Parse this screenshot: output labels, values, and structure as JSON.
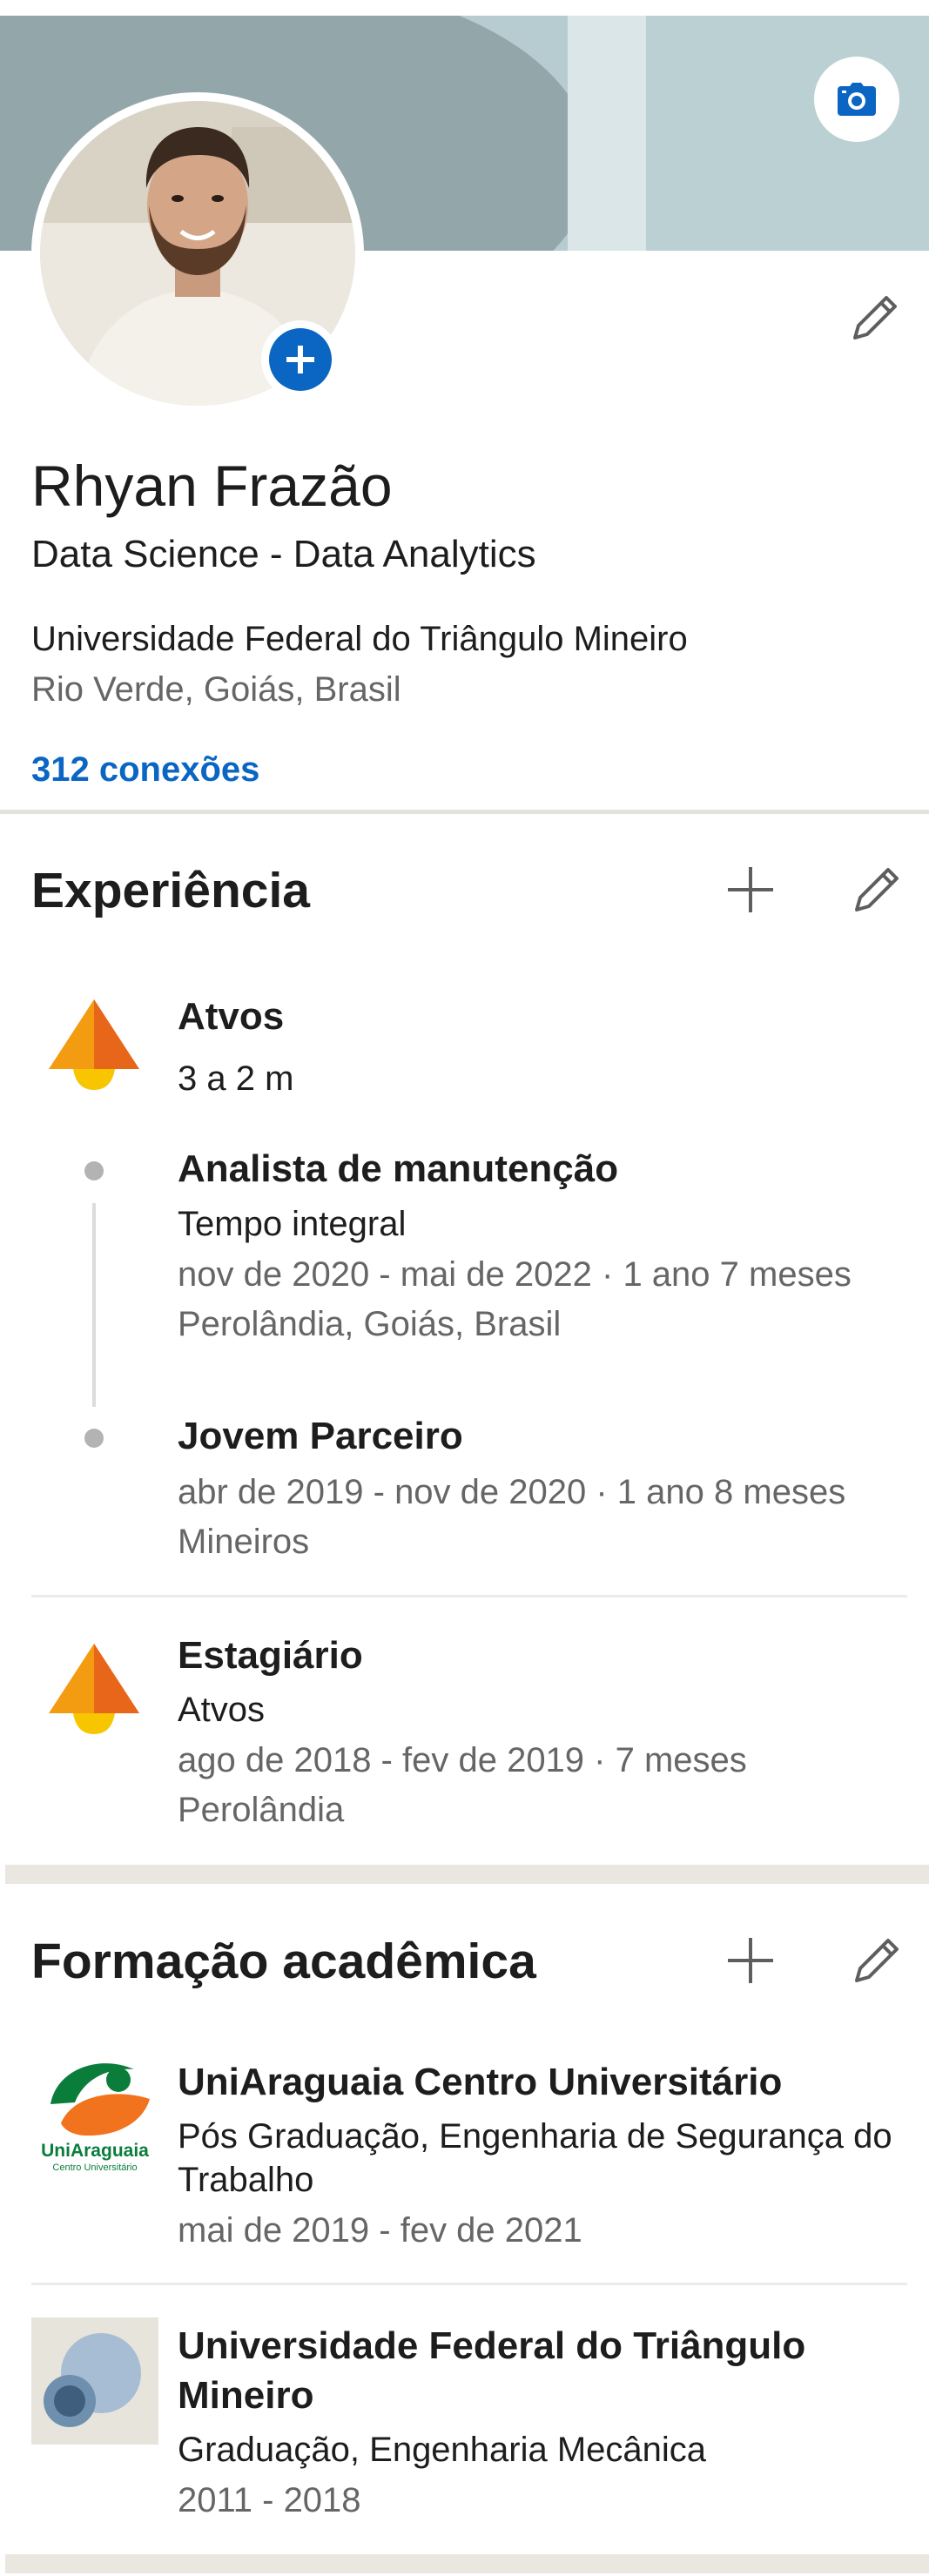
{
  "profile": {
    "name": "Rhyan Frazão",
    "headline": "Data Science - Data Analytics",
    "education": "Universidade Federal do Triângulo Mineiro",
    "location": "Rio Verde, Goiás, Brasil",
    "connections": "312 conexões"
  },
  "experience": {
    "title": "Experiência",
    "companies": [
      {
        "name": "Atvos",
        "duration": "3 a 2 m",
        "roles": [
          {
            "title": "Analista de manutenção",
            "type": "Tempo integral",
            "dates": "nov de 2020 - mai de 2022 · 1 ano 7 meses",
            "location": "Perolândia, Goiás, Brasil"
          },
          {
            "title": "Jovem Parceiro",
            "dates": "abr de 2019 - nov de 2020 · 1 ano 8 meses",
            "location": "Mineiros"
          }
        ]
      },
      {
        "title": "Estagiário",
        "company": "Atvos",
        "dates": "ago de 2018 - fev de 2019 · 7 meses",
        "location": "Perolândia"
      }
    ]
  },
  "education": {
    "title": "Formação acadêmica",
    "items": [
      {
        "school": "UniAraguaia Centro Universitário",
        "degree_line1": "Pós Graduação, Engenharia de Segurança do",
        "degree_line2": "Trabalho",
        "dates": "mai de 2019 - fev de 2021",
        "logo_text": "UniAraguaia",
        "logo_subtext": "Centro Universitário"
      },
      {
        "school_line1": "Universidade Federal do Triângulo",
        "school_line2": "Mineiro",
        "degree": "Graduação, Engenharia Mecânica",
        "dates": "2011 - 2018"
      }
    ]
  },
  "icons": {
    "camera": "camera-icon",
    "add_photo": "plus-icon",
    "edit": "pencil-icon",
    "add": "plus-icon"
  },
  "colors": {
    "accent": "#0a66c2",
    "atvos_orange": "#f39c12",
    "atvos_yellow": "#f7c600",
    "muted_text": "#666666"
  }
}
